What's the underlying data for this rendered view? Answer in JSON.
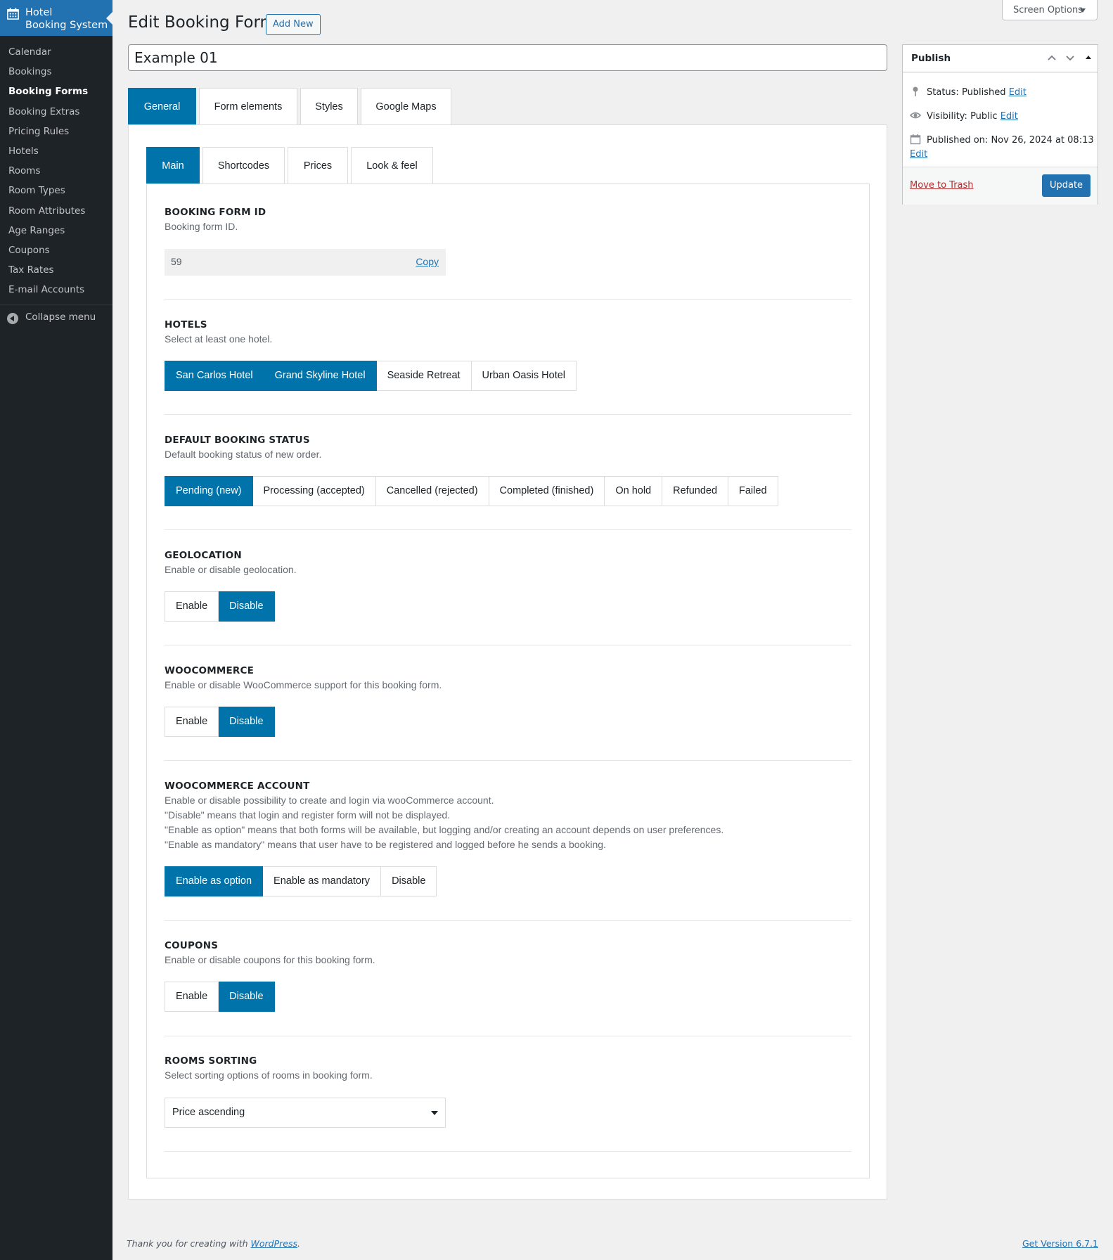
{
  "sidebar": {
    "brand": "Hotel Booking System",
    "brand_line1": "Hotel",
    "brand_line2": "Booking System",
    "items": [
      {
        "label": "Calendar"
      },
      {
        "label": "Bookings"
      },
      {
        "label": "Booking Forms"
      },
      {
        "label": "Booking Extras"
      },
      {
        "label": "Pricing Rules"
      },
      {
        "label": "Hotels"
      },
      {
        "label": "Rooms"
      },
      {
        "label": "Room Types"
      },
      {
        "label": "Room Attributes"
      },
      {
        "label": "Age Ranges"
      },
      {
        "label": "Coupons"
      },
      {
        "label": "Tax Rates"
      },
      {
        "label": "E-mail Accounts"
      }
    ],
    "current": "Booking Forms",
    "collapse_label": "Collapse menu"
  },
  "header": {
    "title": "Edit Booking Form",
    "add_new": "Add New",
    "screen_options": "Screen Options"
  },
  "post_title": "Example 01",
  "outer_tabs": [
    "General",
    "Form elements",
    "Styles",
    "Google Maps"
  ],
  "inner_tabs": [
    "Main",
    "Shortcodes",
    "Prices",
    "Look & feel"
  ],
  "sections": {
    "form_id": {
      "title": "BOOKING FORM ID",
      "desc": "Booking form ID.",
      "value": "59",
      "copy": "Copy"
    },
    "hotels": {
      "title": "HOTELS",
      "desc": "Select at least one hotel.",
      "options": [
        "San Carlos Hotel",
        "Grand Skyline Hotel",
        "Seaside Retreat",
        "Urban Oasis Hotel"
      ],
      "selected": [
        "San Carlos Hotel",
        "Grand Skyline Hotel"
      ]
    },
    "status": {
      "title": "DEFAULT BOOKING STATUS",
      "desc": "Default booking status of new order.",
      "options": [
        "Pending (new)",
        "Processing (accepted)",
        "Cancelled (rejected)",
        "Completed (finished)",
        "On hold",
        "Refunded",
        "Failed"
      ],
      "selected": "Pending (new)"
    },
    "geolocation": {
      "title": "GEOLOCATION",
      "desc": "Enable or disable geolocation.",
      "options": [
        "Enable",
        "Disable"
      ],
      "selected": "Disable"
    },
    "woocommerce": {
      "title": "WOOCOMMERCE",
      "desc": "Enable or disable WooCommerce support for this booking form.",
      "options": [
        "Enable",
        "Disable"
      ],
      "selected": "Disable"
    },
    "woo_account": {
      "title": "WOOCOMMERCE ACCOUNT",
      "desc_lines": [
        "Enable or disable possibility to create and login via wooCommerce account.",
        "\"Disable\" means that login and register form will not be displayed.",
        "\"Enable as option\" means that both forms will be available, but logging and/or creating an account depends on user preferences.",
        "\"Enable as mandatory\" means that user have to be registered and logged before he sends a booking."
      ],
      "options": [
        "Enable as option",
        "Enable as mandatory",
        "Disable"
      ],
      "selected": "Enable as option"
    },
    "coupons": {
      "title": "COUPONS",
      "desc": "Enable or disable coupons for this booking form.",
      "options": [
        "Enable",
        "Disable"
      ],
      "selected": "Disable"
    },
    "sorting": {
      "title": "ROOMS SORTING",
      "desc": "Select sorting options of rooms in booking form.",
      "value": "Price ascending"
    }
  },
  "publish": {
    "title": "Publish",
    "status_label": "Status:",
    "status_value": "Published",
    "visibility_label": "Visibility:",
    "visibility_value": "Public",
    "published_label": "Published on:",
    "published_value": "Nov 26, 2024 at 08:13",
    "edit": "Edit",
    "trash": "Move to Trash",
    "update": "Update"
  },
  "footer": {
    "thanks_prefix": "Thank you for creating with",
    "thanks_link": "WordPress",
    "thanks_suffix": ".",
    "version": "Get Version 6.7.1"
  },
  "colors": {
    "accent": "#0073aa",
    "sidebar": "#1d2327",
    "brand": "#2271b1",
    "trash": "#b32d2e"
  }
}
